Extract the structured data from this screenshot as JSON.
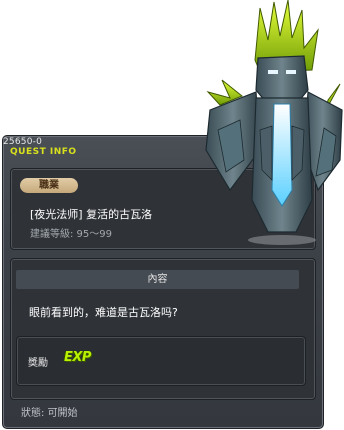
{
  "quest": {
    "id": "25650-0",
    "title": "QUEST INFO",
    "job_label": "職業",
    "name": "[夜光法师] 复活的古瓦洛",
    "recommended_level": "建議等級: 95～99",
    "content_header": "內容",
    "description": "眼前看到的，难道是古瓦洛吗?",
    "reward_label": "獎勵",
    "reward_exp": "EXP",
    "status": "狀態:  可開始"
  },
  "colors": {
    "panel_bg": "#3c4047",
    "title_accent": "#d8e01b",
    "exp_green": "#b8f000",
    "job_badge": "#d4bb8f"
  },
  "icons": {
    "reward": "exp-icon",
    "monster": "guwaru-golem-illustration"
  }
}
